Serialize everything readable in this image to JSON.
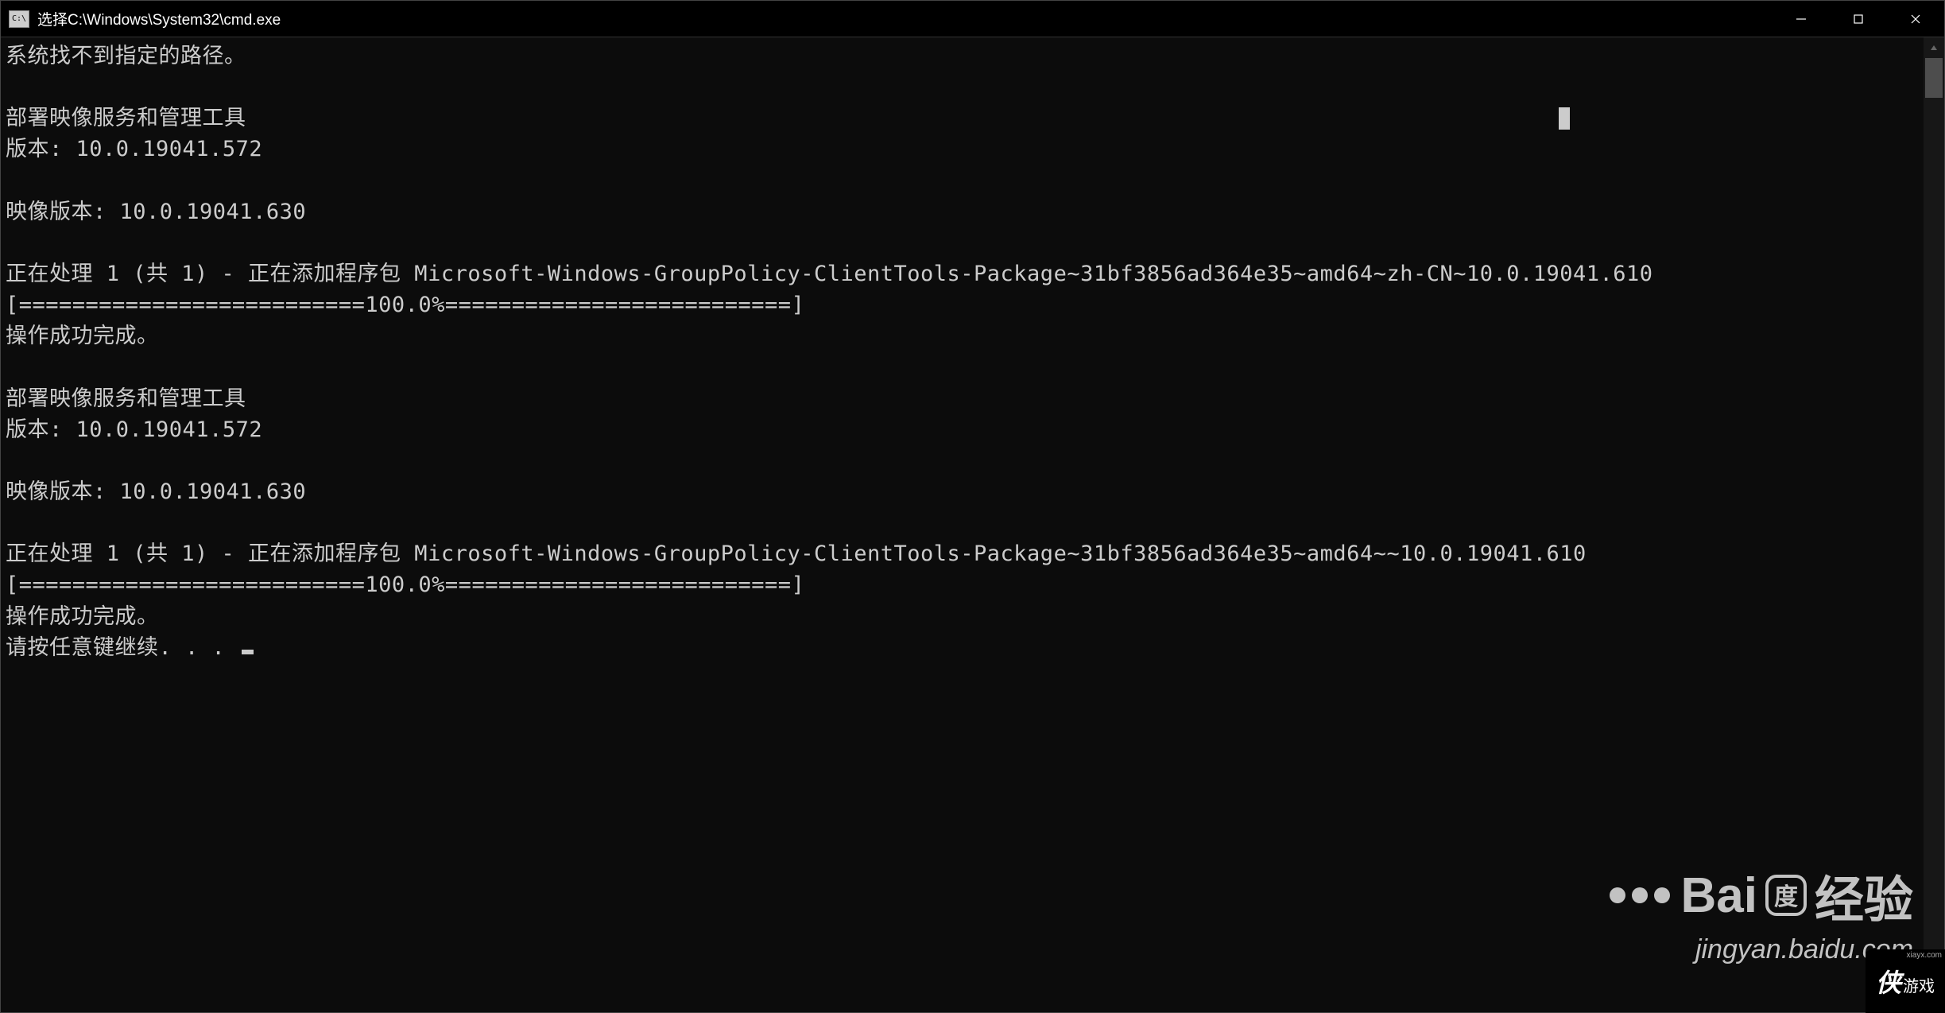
{
  "titlebar": {
    "icon_text": "C:\\",
    "title": "选择C:\\Windows\\System32\\cmd.exe"
  },
  "terminal": {
    "lines": [
      "系统找不到指定的路径。",
      "",
      "部署映像服务和管理工具",
      "版本: 10.0.19041.572",
      "",
      "映像版本: 10.0.19041.630",
      "",
      "正在处理 1 (共 1) - 正在添加程序包 Microsoft-Windows-GroupPolicy-ClientTools-Package~31bf3856ad364e35~amd64~zh-CN~10.0.19041.610",
      "[==========================100.0%==========================]",
      "操作成功完成。",
      "",
      "部署映像服务和管理工具",
      "版本: 10.0.19041.572",
      "",
      "映像版本: 10.0.19041.630",
      "",
      "正在处理 1 (共 1) - 正在添加程序包 Microsoft-Windows-GroupPolicy-ClientTools-Package~31bf3856ad364e35~amd64~~10.0.19041.610",
      "[==========================100.0%==========================]",
      "操作成功完成。"
    ],
    "prompt_line": "请按任意键继续. . . "
  },
  "watermark": {
    "brand_prefix": "Bai",
    "brand_suffix": "经验",
    "url": "jingyan.baidu.com"
  },
  "corner_logo": {
    "big": "侠",
    "small": "游戏",
    "url": "xiayx.com"
  }
}
